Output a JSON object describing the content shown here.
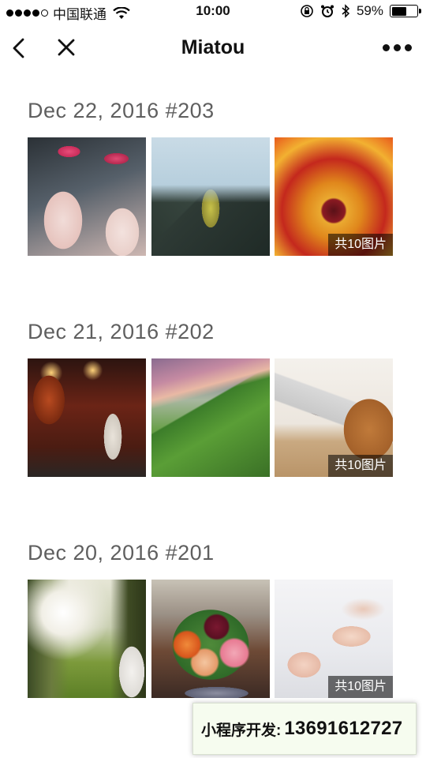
{
  "status_bar": {
    "carrier": "中国联通",
    "time": "10:00",
    "battery_percent": "59%",
    "battery_level": 0.59,
    "icons": [
      "signal-dots-icon",
      "wifi-icon",
      "rotation-lock-icon",
      "alarm-icon",
      "bluetooth-icon",
      "battery-icon"
    ]
  },
  "nav": {
    "title": "Miatou",
    "back_icon": "chevron-left-icon",
    "close_icon": "close-icon",
    "more_icon": "more-dots-icon"
  },
  "sections": [
    {
      "title": "Dec 22, 2016 #203",
      "photos": [
        "flamingos",
        "hiker on mountain",
        "red yellow flower"
      ],
      "overlay": "共10图片"
    },
    {
      "title": "Dec 21, 2016 #202",
      "photos": [
        "japanese izakaya storefront",
        "green valley at dusk",
        "laptop and leather bag"
      ],
      "overlay": "共10图片"
    },
    {
      "title": "Dec 20, 2016 #201",
      "photos": [
        "sunny field",
        "flower bouquet",
        "baby feet"
      ],
      "overlay": "共10图片"
    }
  ],
  "promo": {
    "label": "小程序开发:",
    "phone": "13691612727"
  }
}
